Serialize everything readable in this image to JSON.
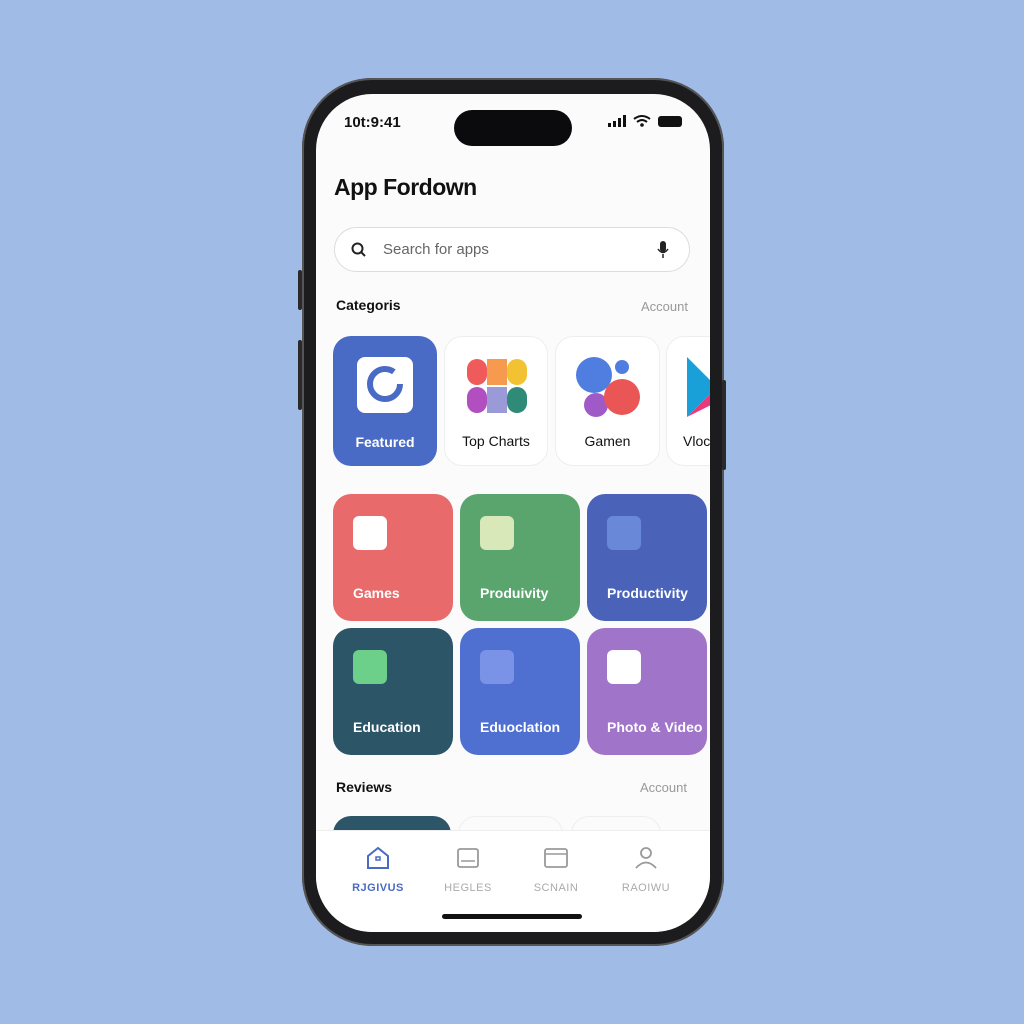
{
  "status": {
    "time": "10t:9:41"
  },
  "header": {
    "title": "App Fordown"
  },
  "search": {
    "placeholder": "Search for apps"
  },
  "categories": {
    "title": "Categoris",
    "link": "Account",
    "top": [
      {
        "label": "Featured"
      },
      {
        "label": "Top Charts"
      },
      {
        "label": "Gamen"
      },
      {
        "label": "Vloc"
      }
    ],
    "grid": [
      {
        "label": "Games",
        "color": "#e86a6a"
      },
      {
        "label": "Produivity",
        "color": "#5aa56e"
      },
      {
        "label": "Productivity",
        "color": "#4a63b8"
      },
      {
        "label": "Education",
        "color": "#2c5568"
      },
      {
        "label": "Eduoclation",
        "color": "#4f70d0"
      },
      {
        "label": "Photo & Video",
        "color": "#a074c8"
      }
    ]
  },
  "reviews": {
    "title": "Reviews",
    "link": "Account"
  },
  "nav": [
    {
      "label": "RJGIVUS",
      "icon": "home-icon",
      "active": true
    },
    {
      "label": "HEGLES",
      "icon": "card-icon"
    },
    {
      "label": "SCNAIN",
      "icon": "window-icon"
    },
    {
      "label": "RAOIWU",
      "icon": "person-icon"
    }
  ],
  "colors": {
    "accent": "#4a6bc5",
    "background": "#a0bce6"
  }
}
